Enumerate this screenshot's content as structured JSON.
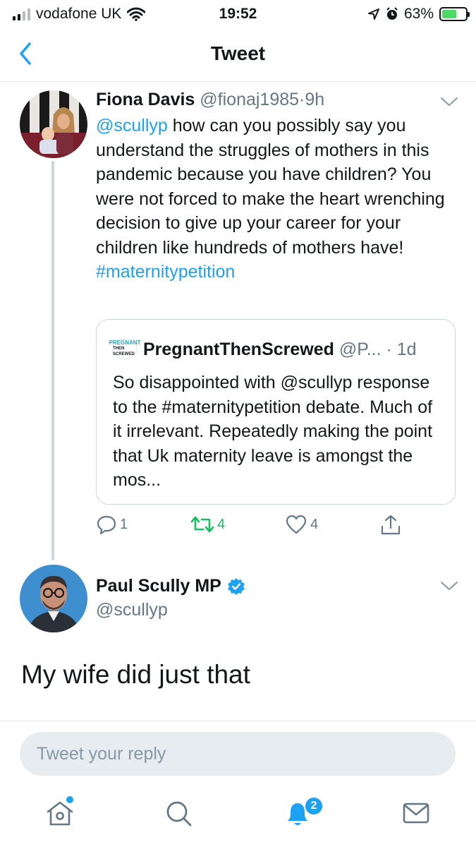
{
  "status_bar": {
    "carrier": "vodafone UK",
    "time": "19:52",
    "battery": "63%",
    "battery_level": 0.63,
    "icons": [
      "signal-icon",
      "wifi-icon",
      "location-icon",
      "alarm-icon",
      "battery-charging-icon"
    ]
  },
  "nav": {
    "title": "Tweet",
    "back_icon": "chevron-left-icon"
  },
  "tweet1": {
    "name": "Fiona Davis",
    "handle": "@fionaj1985",
    "dot": "·",
    "time": "9h",
    "mention": "@scullyp",
    "text": " how can you possibly say you understand the struggles of mothers in this pandemic because you have children? You were not forced to make the heart wrenching decision to give up your career for your children like hundreds of mothers have!",
    "hashtag": "#maternitypetition",
    "quote": {
      "logo_line1": "PREGNANT",
      "logo_line2": "THEN SCREWED",
      "name": "PregnantThenScrewed",
      "handle": "@P...",
      "dot": "·",
      "time": "1d",
      "text": "So disappointed with @scullyp response to the #maternitypetition debate. Much of it irrelevant. Repeatedly making the point that Uk maternity leave is amongst the mos..."
    },
    "actions": {
      "replies": "1",
      "retweets": "4",
      "likes": "4",
      "retweet_color": "#17bf63"
    }
  },
  "tweet2": {
    "name": "Paul Scully MP",
    "handle": "@scullyp",
    "text": "My wife did just that",
    "verified_color": "#1da1f2"
  },
  "reply": {
    "placeholder": "Tweet your reply"
  },
  "tabbar": {
    "notifications_badge": "2",
    "icons": [
      "home-icon",
      "search-icon",
      "bell-icon",
      "mail-icon"
    ],
    "accent": "#1da1f2"
  }
}
